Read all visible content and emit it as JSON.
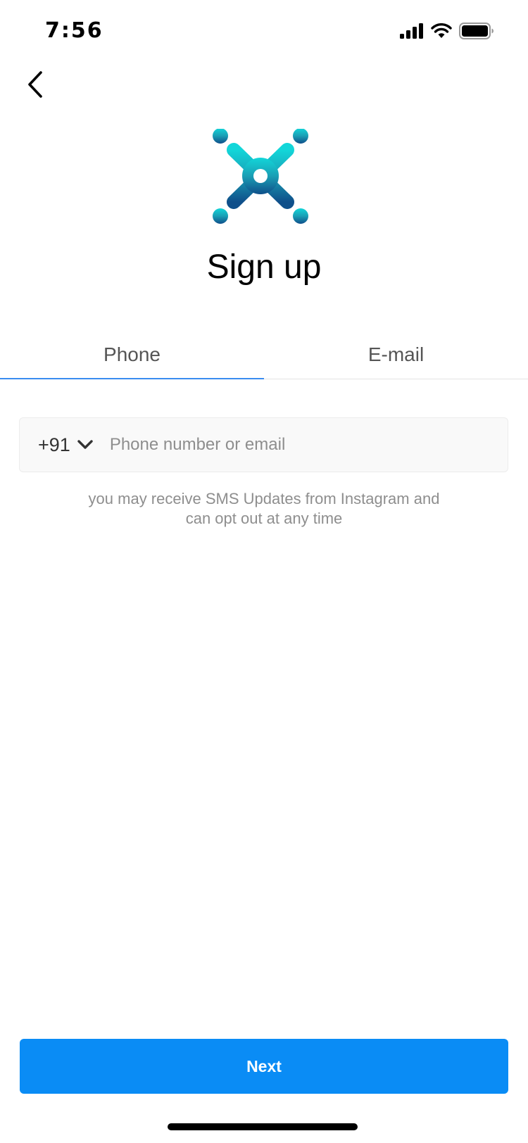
{
  "status_bar": {
    "time": "7:56",
    "icons": [
      "cellular-signal-icon",
      "wifi-icon",
      "battery-icon"
    ]
  },
  "navigation": {
    "back_icon": "chevron-left-icon"
  },
  "logo": {
    "icon": "app-logo-icon",
    "colors": [
      "#12d6d9",
      "#1a9fb5",
      "#0f4f8a"
    ]
  },
  "header": {
    "title": "Sign up"
  },
  "tabs": [
    {
      "label": "Phone",
      "active": true
    },
    {
      "label": "E-mail",
      "active": false
    }
  ],
  "phone_form": {
    "country_code": "+91",
    "country_dropdown_icon": "chevron-down-icon",
    "input_value": "",
    "input_placeholder": "Phone number or email",
    "note_line1": "you may receive SMS Updates from Instagram and",
    "note_line2": "can opt out at any time"
  },
  "actions": {
    "next_label": "Next"
  },
  "colors": {
    "accent": "#0a8cf5",
    "tab_underline": "#3a8cf0",
    "muted_text": "#8e8e8e"
  }
}
